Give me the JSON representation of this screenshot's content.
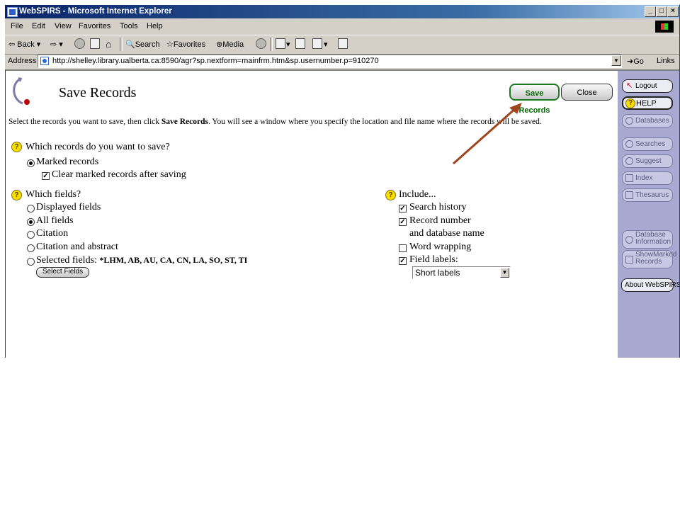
{
  "window": {
    "title": "WebSPIRS - Microsoft Internet Explorer",
    "controls": [
      "_",
      "□",
      "×"
    ]
  },
  "menu": [
    "File",
    "Edit",
    "View",
    "Favorites",
    "Tools",
    "Help"
  ],
  "toolbar": {
    "back": "Back",
    "search": "Search",
    "favorites": "Favorites",
    "media": "Media"
  },
  "address": {
    "label": "Address",
    "url": "http://shelley.library.ualberta.ca:8590/agr?sp.nextform=mainfrm.htm&sp.usernumber.p=910270",
    "go": "Go",
    "links": "Links"
  },
  "page": {
    "title": "Save Records",
    "save_button": "Save Records",
    "close_button": "Close",
    "instructions_pre": "Select the records you want to save, then click ",
    "instructions_bold": "Save Records",
    "instructions_post": ". You will see a window where you specify the location and file name where the records will be saved."
  },
  "records_section": {
    "question": "Which records do you want to save?",
    "marked_records": "Marked records",
    "marked_selected": true,
    "clear_marked": "Clear marked records after saving",
    "clear_checked": true
  },
  "fields_section": {
    "question": "Which fields?",
    "options": [
      {
        "label": "Displayed fields",
        "selected": false
      },
      {
        "label": "All fields",
        "selected": true
      },
      {
        "label": "Citation",
        "selected": false
      },
      {
        "label": "Citation and abstract",
        "selected": false
      },
      {
        "label": "Selected fields:",
        "selected": false
      }
    ],
    "selected_fields_value": "*LHM, AB, AU, CA, CN, LA, SO, ST, TI",
    "select_fields_button": "Select Fields"
  },
  "include_section": {
    "heading": "Include...",
    "search_history": {
      "label": "Search history",
      "checked": true
    },
    "record_number": {
      "label": "Record number",
      "label2": "and database name",
      "checked": true
    },
    "word_wrapping": {
      "label": "Word wrapping",
      "checked": false
    },
    "field_labels": {
      "label": "Field labels:",
      "checked": true
    },
    "field_labels_select": "Short labels"
  },
  "sidebar": {
    "logout": "Logout",
    "help": "HELP",
    "databases": "Databases",
    "searches": "Searches",
    "suggest": "Suggest",
    "index": "Index",
    "thesaurus": "Thesaurus",
    "database_info_1": "Database",
    "database_info_2": "Information",
    "show_marked_1": "ShowMarked",
    "show_marked_2": "Records",
    "about": "About WebSPIRS"
  },
  "colors": {
    "save_button_text": "#006a00",
    "annotation_arrow": "#a0441c",
    "sidebar_bg": "#a8a8d0",
    "help_icon": "#f6df00"
  }
}
